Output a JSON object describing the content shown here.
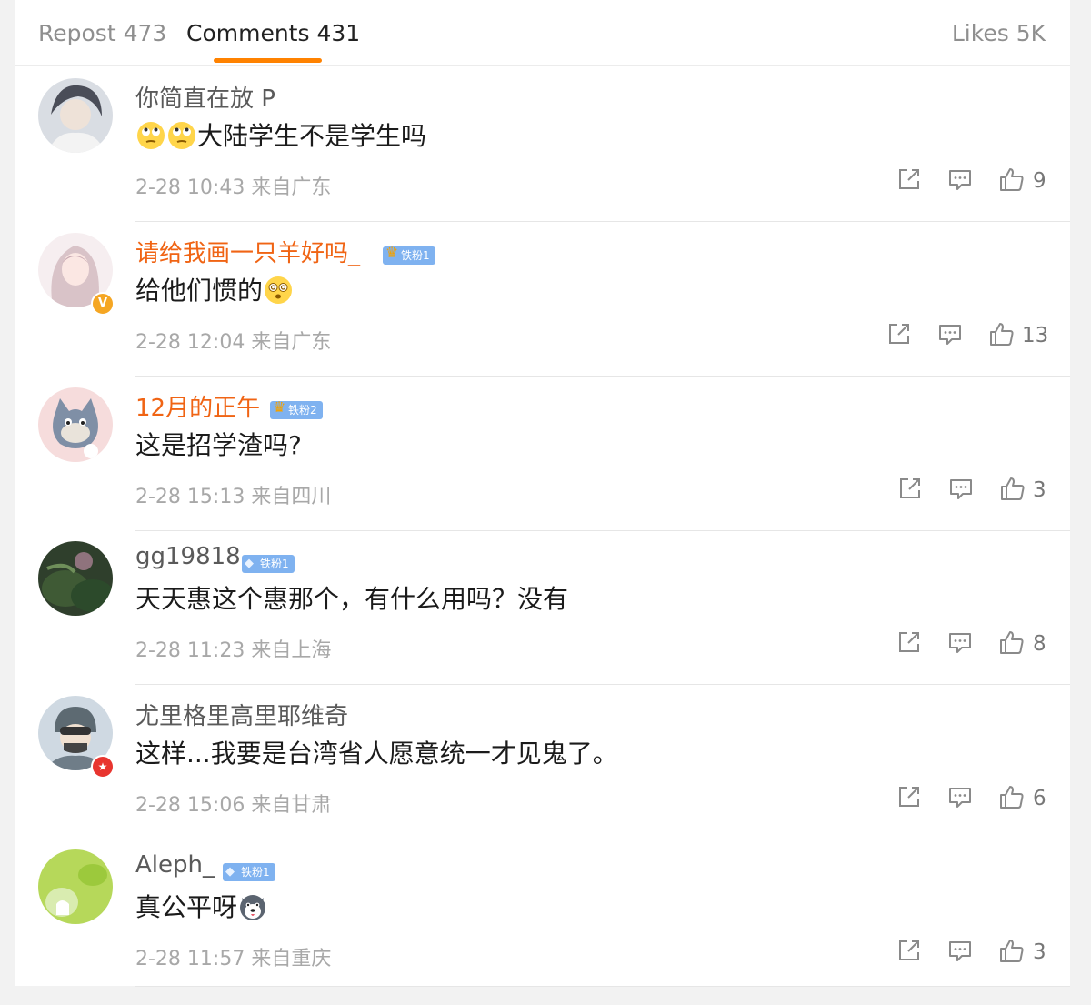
{
  "tabs": {
    "repost": "Repost 473",
    "comments": "Comments 431",
    "likes": "Likes 5K"
  },
  "colors": {
    "accent": "#ff8200",
    "vip_name": "#f06414",
    "fan_badge": "#7fb2f0"
  },
  "comments": [
    {
      "username": "你简直在放 P",
      "text": "大陆学生不是学生吗",
      "emojis": [
        "eye-roll-emoji",
        "eye-roll-emoji"
      ],
      "time": "2-28 10:43 来自广东",
      "likes": "9"
    },
    {
      "username": "请给我画一只羊好吗_",
      "badge": "铁粉1",
      "verified": "V",
      "text": "给他们惯的",
      "emojis": [
        "dizzy-face-emoji"
      ],
      "time": "2-28 12:04 来自广东",
      "likes": "13"
    },
    {
      "username": "12月的正午",
      "badge": "铁粉2",
      "text": "这是招学渣吗?",
      "time": "2-28 15:13 来自四川",
      "likes": "3"
    },
    {
      "username": "gg19818",
      "badge": "铁粉1",
      "text": "天天惠这个惠那个，有什么用吗？没有",
      "time": "2-28 11:23 来自上海",
      "likes": "8"
    },
    {
      "username": "尤里格里高里耶维奇",
      "text": "这样...我要是台湾省人愿意统一才见鬼了。",
      "time": "2-28 15:06 来自甘肃",
      "likes": "6"
    },
    {
      "username": "Aleph_",
      "badge": "铁粉1",
      "text": "真公平呀",
      "emojis": [
        "husky-dog-emoji"
      ],
      "time": "2-28 11:57 来自重庆",
      "likes": "3"
    }
  ]
}
